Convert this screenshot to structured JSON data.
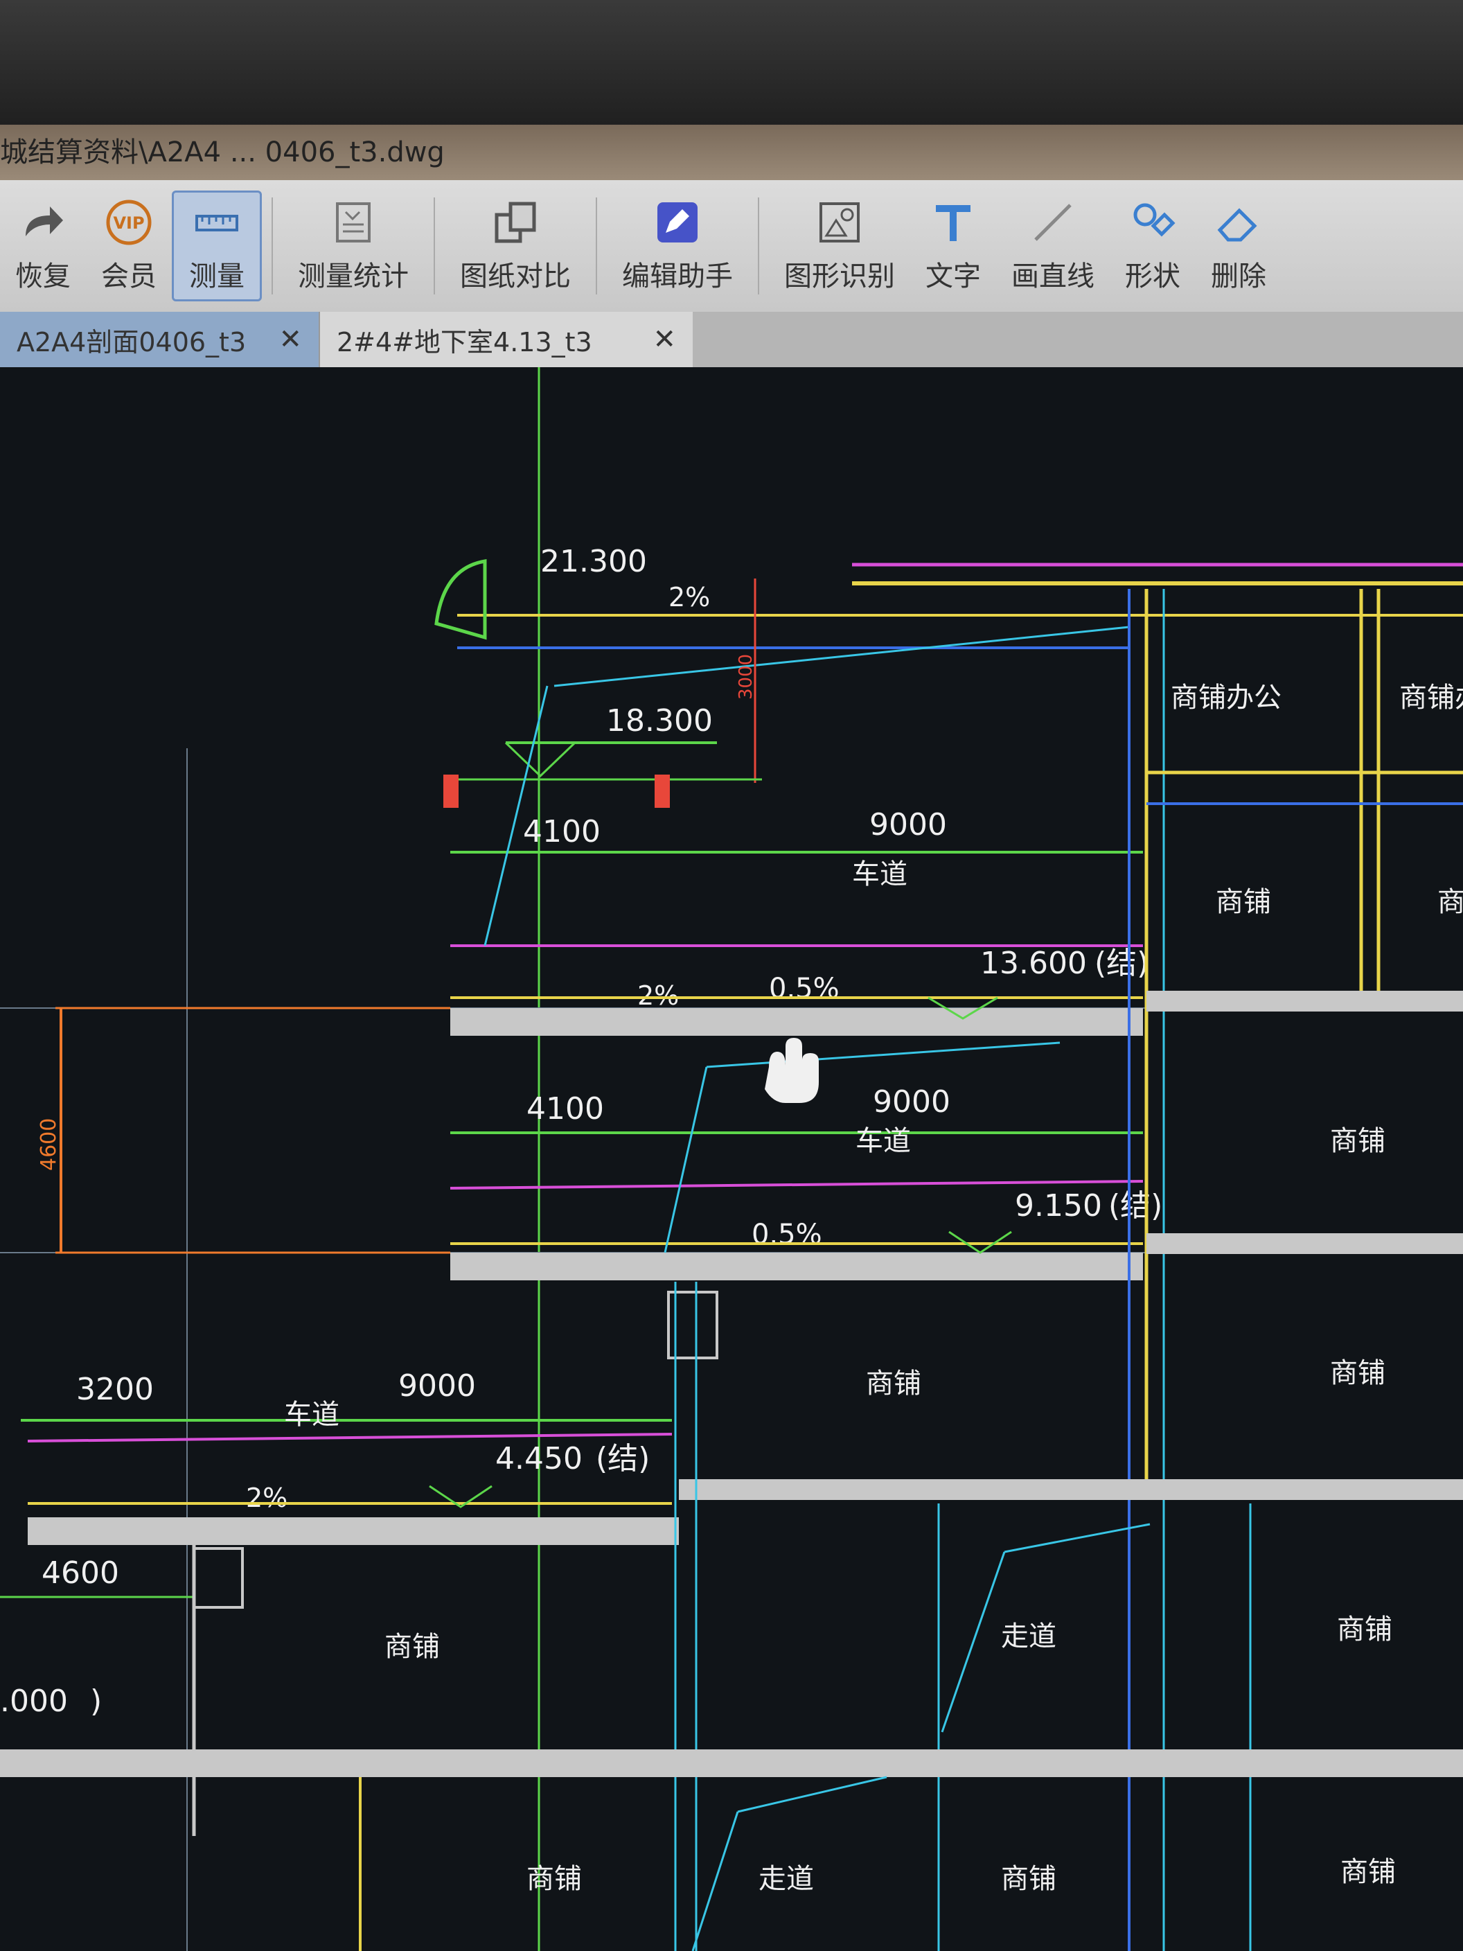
{
  "window": {
    "title": "城结算资料\\A2A4 ... 0406_t3.dwg"
  },
  "toolbar": {
    "items": [
      {
        "label": "恢复",
        "icon": "redo-icon"
      },
      {
        "label": "会员",
        "icon": "vip-icon"
      },
      {
        "label": "测量",
        "icon": "ruler-icon",
        "active": true
      },
      {
        "label": "测量统计",
        "icon": "measure-stats-icon"
      },
      {
        "label": "图纸对比",
        "icon": "compare-icon"
      },
      {
        "label": "编辑助手",
        "icon": "edit-assistant-icon"
      },
      {
        "label": "图形识别",
        "icon": "shape-recognition-icon"
      },
      {
        "label": "文字",
        "icon": "text-icon"
      },
      {
        "label": "画直线",
        "icon": "line-icon"
      },
      {
        "label": "形状",
        "icon": "shape-icon"
      },
      {
        "label": "删除",
        "icon": "eraser-icon"
      }
    ]
  },
  "tabs": [
    {
      "label": "A2A4剖面0406_t3",
      "active": true
    },
    {
      "label": "2#4#地下室4.13_t3",
      "active": false
    }
  ],
  "drawing": {
    "elevations": [
      "21.300",
      "18.300",
      "13.600",
      "9.150",
      "4.450"
    ],
    "struct_mark": "(结)",
    "slopes": [
      "2%",
      "0.5%"
    ],
    "dims": [
      "4100",
      "9000",
      "3200",
      "4600"
    ],
    "labels": {
      "lane": "车道",
      "shop": "商铺",
      "shop_office": "商铺办公",
      "corridor": "走道"
    },
    "partial": {
      "left_elev": ".000",
      "paren_close": ")",
      "shop_cut": "商",
      "shop_office_cut": "商铺办",
      "red_dim": "3000"
    },
    "colors": {
      "green": "#5cd64a",
      "yellow": "#e8d44a",
      "magenta": "#d84fd8",
      "blue": "#3a6fe6",
      "cyan": "#39c6e6",
      "red": "#e8473a",
      "orange": "#f07a2c",
      "gray": "#c8c8c8",
      "white": "#f0f0f0"
    }
  }
}
